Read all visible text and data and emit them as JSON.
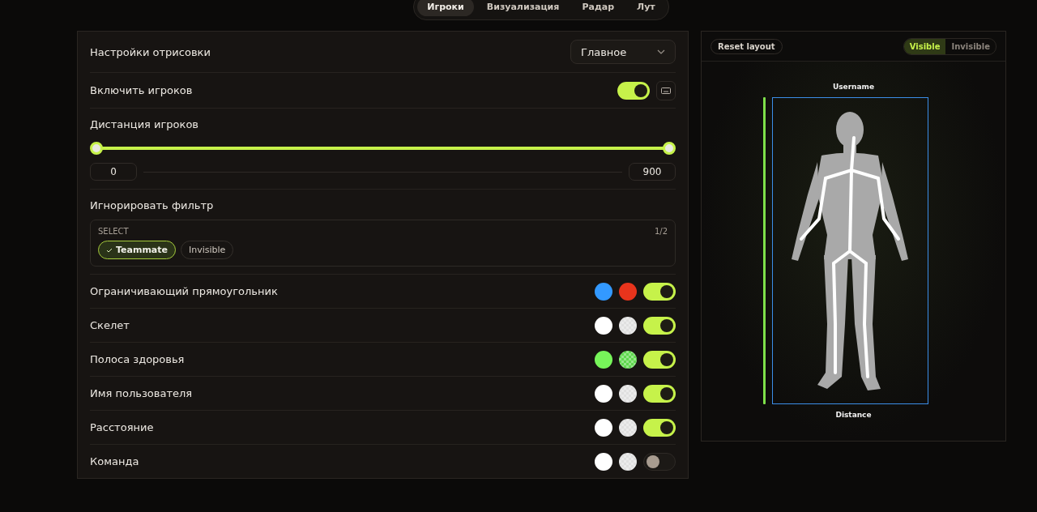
{
  "tabs": [
    {
      "label": "Игроки",
      "selected": true
    },
    {
      "label": "Визуализация",
      "selected": false
    },
    {
      "label": "Радар",
      "selected": false
    },
    {
      "label": "Лут",
      "selected": false
    }
  ],
  "settings": {
    "title": "Настройки отрисовки",
    "dropdown": {
      "value": "Главное"
    }
  },
  "enable": {
    "label": "Включить игроков",
    "on": true
  },
  "distance": {
    "label": "Дистанция игроков",
    "thumbs": [
      {
        "level": 0
      },
      {
        "level": 1
      }
    ],
    "min": "0",
    "max": "900"
  },
  "filter": {
    "label": "Игнорировать фильтр",
    "select_label": "SELECT",
    "count": "1/2",
    "options": [
      {
        "label": "Teammate",
        "selected": true
      },
      {
        "label": "Invisible",
        "selected": false
      }
    ]
  },
  "rows": [
    {
      "label": "Ограничивающий прямоугольник",
      "on": true,
      "swatches": [
        {
          "kind": "solid",
          "color": "#3399ff"
        },
        {
          "kind": "solid",
          "color": "#e8341c"
        }
      ]
    },
    {
      "label": "Скелет",
      "on": true,
      "swatches": [
        {
          "kind": "solid",
          "color": "#ffffff"
        },
        {
          "kind": "checker",
          "color": "#e0e0e0"
        }
      ]
    },
    {
      "label": "Полоса здоровья",
      "on": true,
      "swatches": [
        {
          "kind": "solid",
          "color": "#77f55a"
        },
        {
          "kind": "checker",
          "color": "#5fd84e"
        }
      ]
    },
    {
      "label": "Имя пользователя",
      "on": true,
      "swatches": [
        {
          "kind": "solid",
          "color": "#ffffff"
        },
        {
          "kind": "checker",
          "color": "#e0e0e0"
        }
      ]
    },
    {
      "label": "Расстояние",
      "on": true,
      "swatches": [
        {
          "kind": "solid",
          "color": "#ffffff"
        },
        {
          "kind": "checker",
          "color": "#e0e0e0"
        }
      ]
    },
    {
      "label": "Команда",
      "on": false,
      "swatches": [
        {
          "kind": "solid",
          "color": "#ffffff"
        },
        {
          "kind": "checker",
          "color": "#e0e0e0"
        }
      ]
    }
  ],
  "preview": {
    "reset": "Reset layout",
    "modes": [
      {
        "label": "Visible",
        "selected": true
      },
      {
        "label": "Invisible",
        "selected": false
      }
    ],
    "username": "Username",
    "distance": "Distance"
  }
}
